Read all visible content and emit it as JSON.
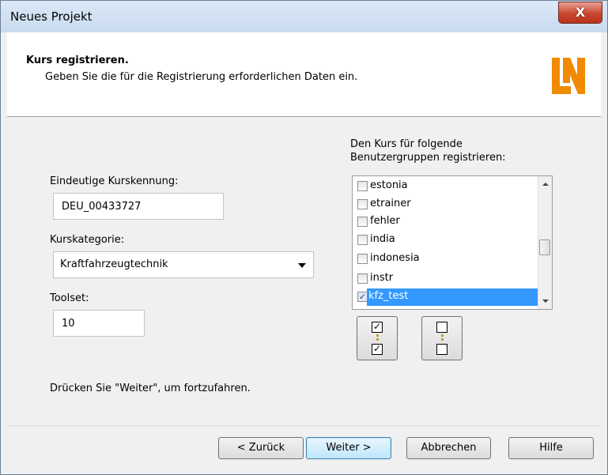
{
  "window": {
    "title": "Neues Projekt",
    "close_glyph": "X"
  },
  "header": {
    "title": "Kurs registrieren.",
    "subtitle": "Geben Sie die für die Registrierung erforderlichen Daten ein.",
    "logo_text": "LN",
    "logo_color": "#f08a00"
  },
  "form": {
    "id_label": "Eindeutige Kurskennung:",
    "id_value": "DEU_00433727",
    "category_label": "Kurskategorie:",
    "category_value": "Kraftfahrzeugtechnik",
    "toolset_label": "Toolset:",
    "toolset_value": "10",
    "groups_label_line1": "Den Kurs für folgende",
    "groups_label_line2": "Benutzergruppen registrieren:",
    "groups": [
      {
        "label": "estonia",
        "checked": false
      },
      {
        "label": "etrainer",
        "checked": false
      },
      {
        "label": "fehler",
        "checked": false
      },
      {
        "label": "india",
        "checked": false
      },
      {
        "label": "indonesia",
        "checked": false
      },
      {
        "label": "instr",
        "checked": false
      },
      {
        "label": "kfz_test",
        "checked": true,
        "selected": true
      }
    ],
    "hint": "Drücken Sie \"Weiter\", um fortzufahren."
  },
  "buttons": {
    "back": "< Zurück",
    "next": "Weiter >",
    "cancel": "Abbrechen",
    "help": "Hilfe"
  },
  "icons": {
    "check_all": "check-all-icon",
    "uncheck_all": "uncheck-all-icon"
  }
}
